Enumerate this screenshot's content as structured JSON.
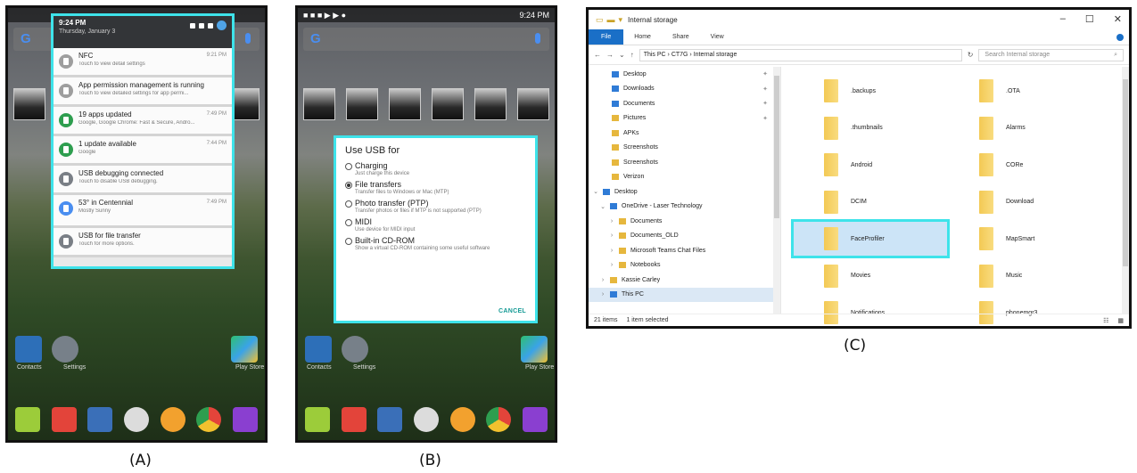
{
  "panelA": {
    "caption": "(A)",
    "shade": {
      "time": "9:24 PM",
      "date": "Thursday, January 3",
      "notifications": [
        {
          "title": "NFC",
          "subtitle": "Touch to view detail settings",
          "time": "9:21 PM",
          "icon_color": "#9e9e9e"
        },
        {
          "title": "App permission management is running",
          "subtitle": "Touch to view detailed settings for app permi...",
          "time": "",
          "icon_color": "#9e9e9e"
        },
        {
          "title": "19 apps updated",
          "subtitle": "Google, Google Chrome: Fast & Secure, Andro...",
          "time": "7:49 PM",
          "icon_color": "#2e9e4f"
        },
        {
          "title": "1 update available",
          "subtitle": "Google",
          "time": "7:44 PM",
          "icon_color": "#2e9e4f"
        },
        {
          "title": "USB debugging connected",
          "subtitle": "Touch to disable USB debugging.",
          "time": "",
          "icon_color": "#7a7f86"
        },
        {
          "title": "53° in Centennial",
          "subtitle": "Mostly Sunny",
          "time": "7:49 PM",
          "icon_color": "#4a8ef0"
        },
        {
          "title": "USB for file transfer",
          "subtitle": "Touch for more options.",
          "time": "",
          "icon_color": "#7a7f86"
        }
      ]
    },
    "dock_labels": [
      "Contacts",
      "Settings",
      "Play Store"
    ]
  },
  "panelB": {
    "caption": "(B)",
    "status_time": "9:24 PM",
    "dialog": {
      "title": "Use USB for",
      "options": [
        {
          "label": "Charging",
          "desc": "Just charge this device",
          "selected": false
        },
        {
          "label": "File transfers",
          "desc": "Transfer files to Windows or Mac (MTP)",
          "selected": true
        },
        {
          "label": "Photo transfer (PTP)",
          "desc": "Transfer photos or files if MTP is not supported (PTP)",
          "selected": false
        },
        {
          "label": "MIDI",
          "desc": "Use device for MIDI input",
          "selected": false
        },
        {
          "label": "Built-in CD-ROM",
          "desc": "Show a virtual CD-ROM containing some useful software",
          "selected": false
        }
      ],
      "cancel": "CANCEL"
    },
    "dock_labels": [
      "Contacts",
      "Settings",
      "Play Store"
    ]
  },
  "panelC": {
    "caption": "(C)",
    "window_title": "Internal storage",
    "ribbon_tabs": [
      "File",
      "Home",
      "Share",
      "View"
    ],
    "breadcrumb": "This PC  ›  CT7G  ›  Internal storage",
    "search_placeholder": "Search Internal storage",
    "nav": [
      {
        "label": "Desktop",
        "blue": true,
        "pinned": true,
        "indent": 10
      },
      {
        "label": "Downloads",
        "blue": true,
        "pinned": true,
        "indent": 10
      },
      {
        "label": "Documents",
        "blue": true,
        "pinned": true,
        "indent": 10
      },
      {
        "label": "Pictures",
        "blue": false,
        "pinned": true,
        "indent": 10
      },
      {
        "label": "APKs",
        "blue": false,
        "pinned": false,
        "indent": 10
      },
      {
        "label": "Screenshots",
        "blue": false,
        "pinned": false,
        "indent": 10
      },
      {
        "label": "Screenshots",
        "blue": false,
        "pinned": false,
        "indent": 10
      },
      {
        "label": "Verizon",
        "blue": false,
        "pinned": false,
        "indent": 10
      },
      {
        "label": "Desktop",
        "blue": true,
        "pinned": false,
        "indent": 0,
        "arrow": "⌄"
      },
      {
        "label": "OneDrive - Laser Technology",
        "blue": true,
        "pinned": false,
        "indent": 8,
        "arrow": "⌄"
      },
      {
        "label": "Documents",
        "blue": false,
        "pinned": false,
        "indent": 18,
        "arrow": "›"
      },
      {
        "label": "Documents_OLD",
        "blue": false,
        "pinned": false,
        "indent": 18,
        "arrow": "›"
      },
      {
        "label": "Microsoft Teams Chat Files",
        "blue": false,
        "pinned": false,
        "indent": 18,
        "arrow": "›"
      },
      {
        "label": "Notebooks",
        "blue": false,
        "pinned": false,
        "indent": 18,
        "arrow": "›"
      },
      {
        "label": "Kassie Carley",
        "blue": false,
        "pinned": false,
        "indent": 8,
        "arrow": "›"
      },
      {
        "label": "This PC",
        "blue": true,
        "pinned": false,
        "indent": 8,
        "arrow": "›",
        "selected": true
      }
    ],
    "files_left": [
      ".backups",
      ".thumbnails",
      "Android",
      "DCIM",
      "FaceProfiler",
      "Movies",
      "Notifications"
    ],
    "files_right": [
      ".OTA",
      "Alarms",
      "CORe",
      "Download",
      "MapSmart",
      "Music",
      "phonemgr3"
    ],
    "item_count": "21 items",
    "selection": "1 item selected"
  }
}
